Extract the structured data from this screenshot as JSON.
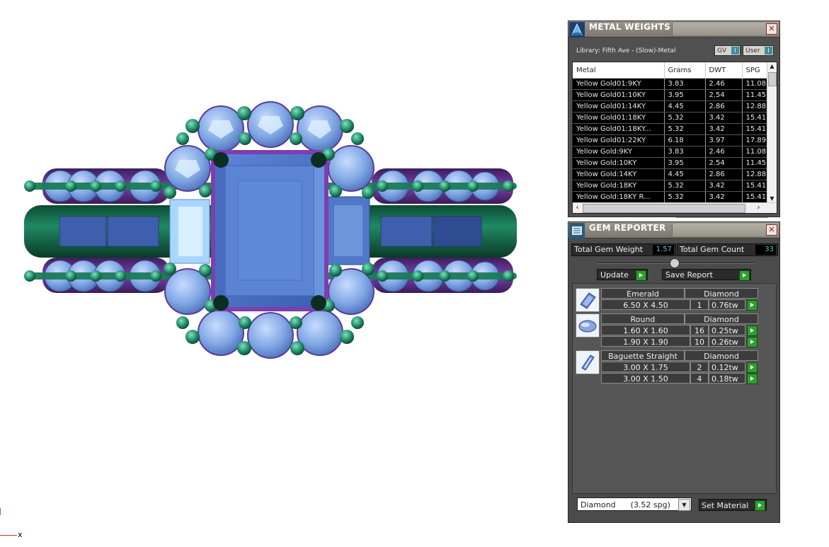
{
  "viewport": {
    "axis_label": "x"
  },
  "metal_weights": {
    "title": "METAL WEIGHTS",
    "library_label": "Library: Fifth Ave - (Slow)-Metal",
    "toggles": [
      {
        "label": "GV",
        "indicator": "I"
      },
      {
        "label": "User",
        "indicator": "I"
      }
    ],
    "close": "✕",
    "columns": [
      "Metal",
      "Grams",
      "DWT",
      "SPG"
    ],
    "rows": [
      [
        "Yellow Gold01:9KY",
        "3.83",
        "2.46",
        "11.08"
      ],
      [
        "Yellow Gold01:10KY",
        "3.95",
        "2.54",
        "11.45"
      ],
      [
        "Yellow Gold01:14KY",
        "4.45",
        "2.86",
        "12.88"
      ],
      [
        "Yellow Gold01:18KY",
        "5.32",
        "3.42",
        "15.41"
      ],
      [
        "Yellow Gold01:18KY...",
        "5.32",
        "3.42",
        "15.41"
      ],
      [
        "Yellow Gold01:22KY",
        "6.18",
        "3.97",
        "17.89"
      ],
      [
        "Yellow Gold:9KY",
        "3.83",
        "2.46",
        "11.08"
      ],
      [
        "Yellow Gold:10KY",
        "3.95",
        "2.54",
        "11.45"
      ],
      [
        "Yellow Gold:14KY",
        "4.45",
        "2.86",
        "12.88"
      ],
      [
        "Yellow Gold:18KY",
        "5.32",
        "3.42",
        "15.41"
      ],
      [
        "Yellow Gold:18KY R...",
        "5.32",
        "3.42",
        "15.41"
      ]
    ]
  },
  "gem_reporter": {
    "title": "GEM REPORTER",
    "close": "✕",
    "total_weight_label": "Total Gem Weight",
    "total_weight_value": "1.57",
    "total_count_label": "Total Gem Count",
    "total_count_value": "33",
    "update_label": "Update",
    "save_report_label": "Save Report",
    "groups": [
      {
        "shape": "Emerald",
        "material": "Diamond",
        "icon": "emerald-cut-icon",
        "rows": [
          {
            "size": "6.50 X 4.50",
            "count": "1",
            "weight": "0.76tw"
          }
        ]
      },
      {
        "shape": "Round",
        "material": "Diamond",
        "icon": "round-cut-icon",
        "rows": [
          {
            "size": "1.60 X 1.60",
            "count": "16",
            "weight": "0.25tw"
          },
          {
            "size": "1.90 X 1.90",
            "count": "10",
            "weight": "0.26tw"
          }
        ]
      },
      {
        "shape": "Baguette Straight",
        "material": "Diamond",
        "icon": "baguette-cut-icon",
        "rows": [
          {
            "size": "3.00 X 1.75",
            "count": "2",
            "weight": "0.12tw"
          },
          {
            "size": "3.00 X 1.50",
            "count": "4",
            "weight": "0.18tw"
          }
        ]
      }
    ],
    "material_select": "Diamond      (3.52 spg)",
    "set_material_label": "Set Material"
  }
}
